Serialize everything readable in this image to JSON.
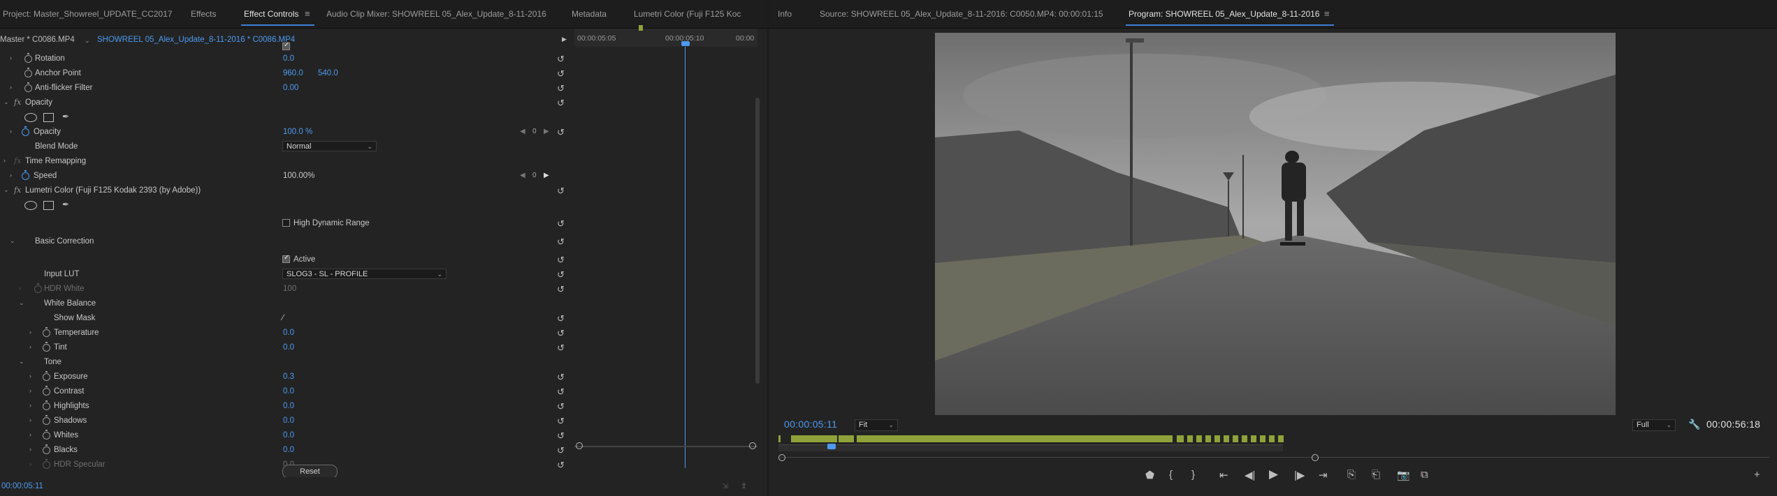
{
  "left_panel": {
    "tabs": [
      {
        "label": "Project: Master_Showreel_UPDATE_CC2017"
      },
      {
        "label": "Effects"
      },
      {
        "label": "Effect Controls"
      },
      {
        "label": "Audio Clip Mixer: SHOWREEL 05_Alex_Update_8-11-2016"
      },
      {
        "label": "Metadata"
      },
      {
        "label": "Lumetri Color (Fuji F125 Koc"
      }
    ],
    "clip_bar": {
      "master": "Master * C0086.MP4",
      "sequence": "SHOWREEL 05_Alex_Update_8-11-2016 * C0086.MP4"
    },
    "mini_timeline": {
      "label_1": "00:00:05:05",
      "label_2": "00:00:05:10",
      "label_3": "00:00"
    },
    "rows": {
      "rotation": {
        "label": "Rotation",
        "value": "0.0"
      },
      "anchor": {
        "label": "Anchor Point",
        "x": "960.0",
        "y": "540.0"
      },
      "antiflicker": {
        "label": "Anti-flicker Filter",
        "value": "0.00"
      },
      "opacity_fx": {
        "label": "Opacity"
      },
      "opacity": {
        "label": "Opacity",
        "value": "100.0 %",
        "kf": "0"
      },
      "blend": {
        "label": "Blend Mode",
        "value": "Normal"
      },
      "time_remap": {
        "label": "Time Remapping"
      },
      "speed": {
        "label": "Speed",
        "value": "100.00%",
        "kf": "0"
      },
      "lumetri": {
        "label": "Lumetri Color (Fuji F125 Kodak 2393 (by Adobe))"
      },
      "hdr_range": {
        "label": "High Dynamic Range"
      },
      "basic": {
        "label": "Basic Correction"
      },
      "active": {
        "label": "Active"
      },
      "input_lut": {
        "label": "Input LUT",
        "value": "SLOG3 - SL - PROFILE"
      },
      "hdr_white": {
        "label": "HDR White",
        "value": "100"
      },
      "wb": {
        "label": "White Balance"
      },
      "show_mask": {
        "label": "Show Mask"
      },
      "temperature": {
        "label": "Temperature",
        "value": "0.0"
      },
      "tint": {
        "label": "Tint",
        "value": "0.0"
      },
      "tone": {
        "label": "Tone"
      },
      "exposure": {
        "label": "Exposure",
        "value": "0.3"
      },
      "contrast": {
        "label": "Contrast",
        "value": "0.0"
      },
      "highlights": {
        "label": "Highlights",
        "value": "0.0"
      },
      "shadows": {
        "label": "Shadows",
        "value": "0.0"
      },
      "whites": {
        "label": "Whites",
        "value": "0.0"
      },
      "blacks": {
        "label": "Blacks",
        "value": "0.0"
      },
      "hdr_specular": {
        "label": "HDR Specular",
        "value": "0.0"
      }
    },
    "reset_label": "Reset",
    "timecode": "00:00:05:11"
  },
  "right_panel": {
    "tabs": [
      {
        "label": "Info"
      },
      {
        "label": "Source: SHOWREEL 05_Alex_Update_8-11-2016: C0050.MP4: 00:00:01:15"
      },
      {
        "label": "Program: SHOWREEL 05_Alex_Update_8-11-2016"
      }
    ],
    "timecode_current": "00:00:05:11",
    "timecode_duration": "00:00:56:18",
    "zoom": "Fit",
    "resolution": "Full"
  },
  "colors": {
    "accent": "#4d9af0",
    "marker": "#8fa23a",
    "panel": "#232323"
  }
}
